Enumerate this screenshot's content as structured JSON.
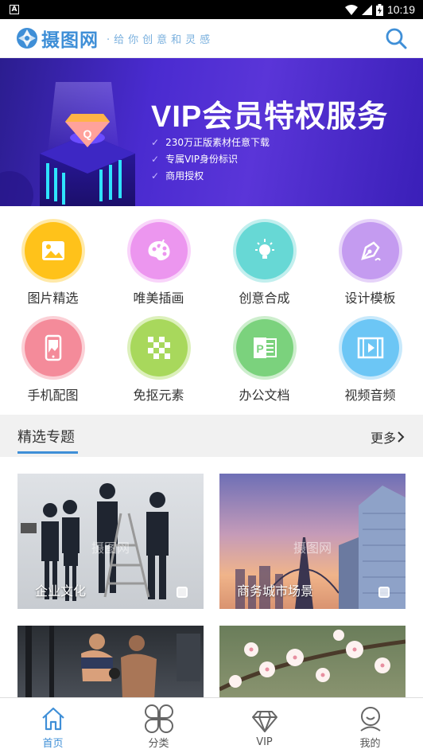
{
  "status_bar": {
    "time": "10:19"
  },
  "header": {
    "logo_text": "摄图网",
    "slogan": "·给你创意和灵感"
  },
  "banner": {
    "title": "VIP会员特权服务",
    "features": [
      "230万正版素材任意下载",
      "专属VIP身份标识",
      "商用授权"
    ]
  },
  "categories": [
    {
      "label": "图片精选",
      "icon": "image-icon",
      "color": "#ffc21a"
    },
    {
      "label": "唯美插画",
      "icon": "palette-icon",
      "color": "#ec96ef"
    },
    {
      "label": "创意合成",
      "icon": "lightbulb-icon",
      "color": "#67d8d5"
    },
    {
      "label": "设计模板",
      "icon": "pen-tool-icon",
      "color": "#c49bf0"
    },
    {
      "label": "手机配图",
      "icon": "phone-image-icon",
      "color": "#f48b9a"
    },
    {
      "label": "免抠元素",
      "icon": "checkerboard-icon",
      "color": "#a8d85c"
    },
    {
      "label": "办公文档",
      "icon": "powerpoint-icon",
      "color": "#7bd27d"
    },
    {
      "label": "视频音频",
      "icon": "video-icon",
      "color": "#6cc6f5"
    }
  ],
  "section": {
    "title": "精选专题",
    "more": "更多"
  },
  "cards": [
    {
      "label": "企业文化",
      "watermark": "摄图网"
    },
    {
      "label": "商务城市场景",
      "watermark": "摄图网"
    },
    {
      "label": ""
    },
    {
      "label": ""
    }
  ],
  "bottom_nav": [
    {
      "label": "首页",
      "icon": "home-icon",
      "active": true
    },
    {
      "label": "分类",
      "icon": "grid-flower-icon",
      "active": false
    },
    {
      "label": "VIP",
      "icon": "diamond-icon",
      "active": false
    },
    {
      "label": "我的",
      "icon": "user-icon",
      "active": false
    }
  ],
  "colors": {
    "accent": "#3f8fd7",
    "banner_bg": "#4a2bd0",
    "section_bg": "#f1f1f1"
  }
}
